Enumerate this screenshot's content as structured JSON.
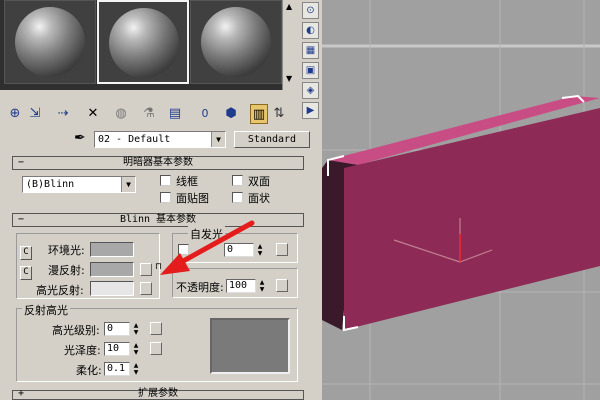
{
  "material_editor": {
    "material_name": "02 - Default",
    "material_type": "Standard",
    "shader_rollout": {
      "title": "明暗器基本参数",
      "shader": "(B)Blinn",
      "options": [
        {
          "label": "线框",
          "checked": false
        },
        {
          "label": "双面",
          "checked": false
        },
        {
          "label": "面贴图",
          "checked": false
        },
        {
          "label": "面状",
          "checked": false
        }
      ]
    },
    "blinn_rollout": {
      "title": "Blinn 基本参数",
      "ambient_label": "环境光:",
      "diffuse_label": "漫反射:",
      "specular_label": "高光反射:",
      "self_illum_label": "自发光",
      "self_illum_value": "0",
      "opacity_label": "不透明度:",
      "opacity_value": "100",
      "spec_highlights_label": "反射高光",
      "spec_level_label": "高光级别:",
      "spec_level_value": "0",
      "gloss_label": "光泽度:",
      "gloss_value": "10",
      "soften_label": "柔化:",
      "soften_value": "0.1"
    },
    "extended_rollout": {
      "title": "扩展参数"
    }
  },
  "colors": {
    "box_front": "#8e2a56",
    "box_top": "#c94d85",
    "ambient": "#a8a8a8",
    "diffuse": "#a8a8a8",
    "specular": "#e6e6e6",
    "highlight_preview": "#7a7a7a",
    "arrow": "#e41c1c",
    "toolbar_active": "#e8c56a"
  },
  "icons": {
    "minus": "−",
    "dropdown": "▼",
    "scroll_up": "▲",
    "scroll_down": "▼",
    "lock": "🔒"
  }
}
